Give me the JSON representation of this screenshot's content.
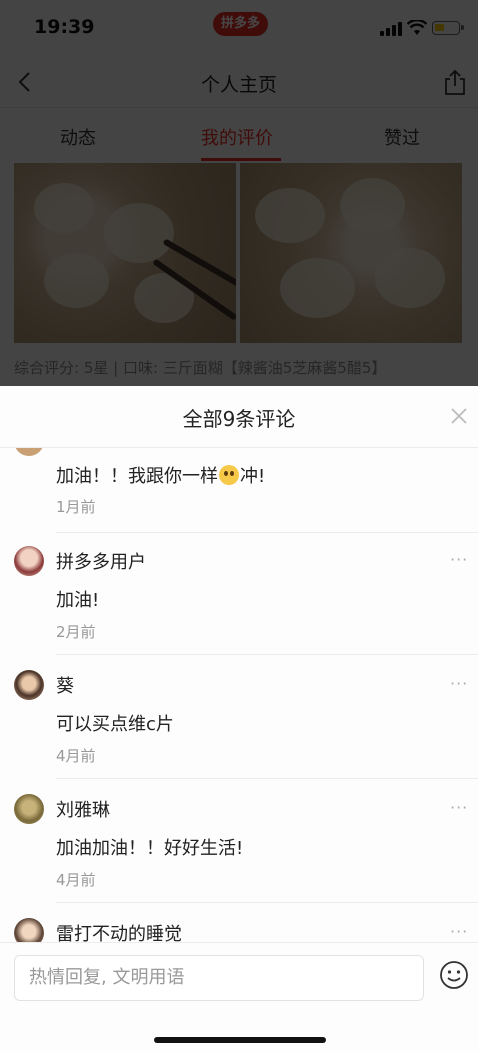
{
  "status_bar": {
    "time": "19:39",
    "app_badge": "拼多多",
    "battery_color": "#f5c400"
  },
  "nav": {
    "title": "个人主页",
    "back_icon": "chevron-left-icon",
    "share_icon": "share-icon"
  },
  "tabs": [
    {
      "label": "动态",
      "active": false
    },
    {
      "label": "我的评价",
      "active": true
    },
    {
      "label": "赞过",
      "active": false
    }
  ],
  "review": {
    "summary": "综合评分: 5星 | 口味: 三斤面糊【辣酱油5芝麻酱5醋5】"
  },
  "sheet": {
    "title": "全部9条评论",
    "close_icon": "close-icon"
  },
  "comments": [
    {
      "text_before": "加油！！我跟你一样",
      "emoji": "crying-face-emoji",
      "text_after": "冲!",
      "time": "1月前"
    },
    {
      "name": "拼多多用户",
      "text": "加油!",
      "time": "2月前",
      "more": "···"
    },
    {
      "name": "葵",
      "text": "可以买点维c片",
      "time": "4月前",
      "more": "···"
    },
    {
      "name": "刘雅琳",
      "text": "加油加油！！好好生活!",
      "time": "4月前",
      "more": "···"
    },
    {
      "name": "雷打不动的睡觉",
      "more": "···"
    }
  ],
  "input": {
    "placeholder": "热情回复, 文明用语",
    "emoji_icon": "emoji-smile-icon"
  },
  "colors": {
    "accent": "#e02e24",
    "secondary_text": "#999999"
  }
}
